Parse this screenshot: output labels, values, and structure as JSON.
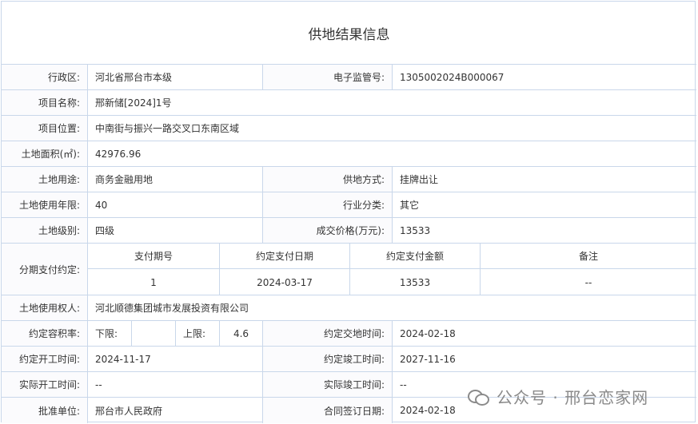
{
  "title": "供地结果信息",
  "rows": {
    "district": {
      "label": "行政区:",
      "value": "河北省邢台市本级"
    },
    "monitor_no": {
      "label": "电子监管号:",
      "value": "1305002024B000067"
    },
    "project_name": {
      "label": "项目名称:",
      "value": "邢新储[2024]1号"
    },
    "project_location": {
      "label": "项目位置:",
      "value": "中南街与振兴一路交叉口东南区域"
    },
    "land_area": {
      "label": "土地面积(㎡):",
      "value": "42976.96"
    },
    "land_use": {
      "label": "土地用途:",
      "value": "商务金融用地"
    },
    "supply_method": {
      "label": "供地方式:",
      "value": "挂牌出让"
    },
    "use_years": {
      "label": "土地使用年限:",
      "value": "40"
    },
    "industry": {
      "label": "行业分类:",
      "value": "其它"
    },
    "land_grade": {
      "label": "土地级别:",
      "value": "四级"
    },
    "deal_price": {
      "label": "成交价格(万元):",
      "value": "13533"
    },
    "installments": {
      "label": "分期支付约定:",
      "headers": [
        "支付期号",
        "约定支付日期",
        "约定支付金额",
        "备注"
      ],
      "rows": [
        [
          "1",
          "2024-03-17",
          "13533",
          "--"
        ]
      ]
    },
    "land_user": {
      "label": "土地使用权人:",
      "value": "河北顺德集团城市发展投资有限公司"
    },
    "plot_ratio": {
      "label": "约定容积率:",
      "lower_label": "下限:",
      "lower_value": "",
      "upper_label": "上限:",
      "upper_value": "4.6"
    },
    "handover_time": {
      "label": "约定交地时间:",
      "value": "2024-02-18"
    },
    "start_time": {
      "label": "约定开工时间:",
      "value": "2024-11-17"
    },
    "completion_time": {
      "label": "约定竣工时间:",
      "value": "2027-11-16"
    },
    "actual_start": {
      "label": "实际开工时间:",
      "value": "--"
    },
    "actual_completion": {
      "label": "实际竣工时间:",
      "value": "--"
    },
    "approval_unit": {
      "label": "批准单位:",
      "value": "邢台市人民政府"
    },
    "contract_date": {
      "label": "合同签订日期:",
      "value": "2024-02-18"
    }
  },
  "watermark": {
    "text": "公众号 · 邢台恋家网",
    "icon": "wechat-icon"
  }
}
